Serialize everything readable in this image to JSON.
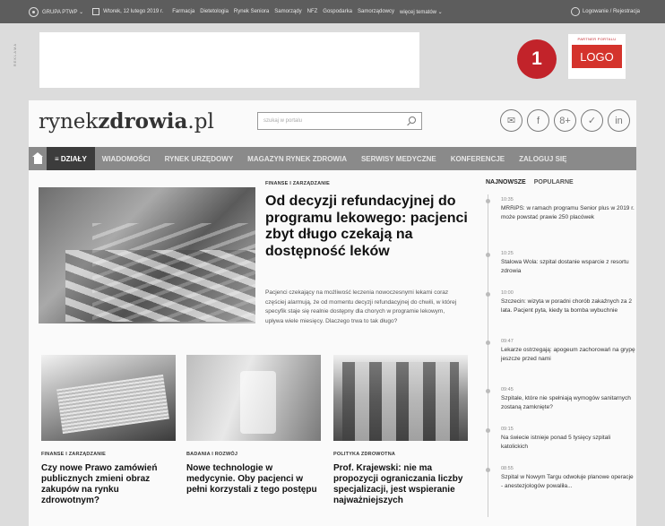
{
  "topbar": {
    "grupa": "GRUPA PTWP ⌄",
    "date": "Wtorek, 12 lutego 2019 r.",
    "links": [
      "Farmacja",
      "Dietetologia",
      "Rynek Seniora",
      "Samorządy",
      "NFZ",
      "Gospodarka",
      "Samorządowcy",
      "więcej tematów ⌄"
    ],
    "login": "Logowanie / Rejestracja"
  },
  "ad": {
    "label": "REKLAMA"
  },
  "callout_number": "1",
  "partner": {
    "label": "PARTNER PORTALU",
    "logo": "LOGO"
  },
  "site": {
    "brand_a": "rynek",
    "brand_b": "zdrowia",
    "brand_c": ".pl",
    "search_placeholder": "szukaj w portalu",
    "socials": [
      "✉",
      "f",
      "8+",
      "✓",
      "in"
    ]
  },
  "nav": {
    "dzialy": "≡ DZIAŁY",
    "items": [
      "WIADOMOŚCI",
      "RYNEK URZĘDOWY",
      "MAGAZYN RYNEK ZDROWIA",
      "SERWISY MEDYCZNE",
      "KONFERENCJE",
      "ZALOGUJ SIĘ"
    ]
  },
  "main_article": {
    "category": "FINANSE I ZARZĄDZANIE",
    "title": "Od decyzji refundacyjnej do programu lekowego: pacjenci zbyt długo czekają na dostępność leków",
    "lead": "Pacjenci czekający na możliwość leczenia nowoczesnymi lekami coraz częściej alarmują, że od momentu decyzji refundacyjnej do chwili, w której specyfik staje się realnie dostępny dla chorych w programie lekowym, upływa wiele miesięcy. Dlaczego trwa to tak długo?"
  },
  "articles": [
    {
      "category": "FINANSE I ZARZĄDZANIE",
      "title": "Czy nowe Prawo zamówień publicznych zmieni obraz zakupów na rynku zdrowotnym?"
    },
    {
      "category": "BADANIA I ROZWÓJ",
      "title": "Nowe technologie w medycynie. Oby pacjenci w pełni korzystali z tego postępu"
    },
    {
      "category": "POLITYKA ZDROWOTNA",
      "title": "Prof. Krajewski: nie ma propozycji ograniczania liczby specjalizacji, jest wspieranie najważniejszych"
    }
  ],
  "sidebar": {
    "tab_newest": "NAJNOWSZE",
    "tab_popular": "POPULARNE",
    "news": [
      {
        "time": "10:35",
        "text": "MRRiPS: w ramach programu Senior plus w 2019 r. może powstać prawie 250 placówek"
      },
      {
        "time": "10:25",
        "text": "Stalowa Wola: szpital dostanie wsparcie z resortu zdrowia"
      },
      {
        "time": "10:00",
        "text": "Szczecin: wizyta w poradni chorób zakaźnych za 2 lata. Pacjent pyta, kiedy ta bomba wybuchnie"
      },
      {
        "time": "09:47",
        "text": "Lekarze ostrzegają: apogeum zachorowań na grypę jeszcze przed nami"
      },
      {
        "time": "09:45",
        "text": "Szpitale, które nie spełniają wymogów sanitarnych zostaną zamknięte?"
      },
      {
        "time": "09:15",
        "text": "Na świecie istnieje ponad 5 tysięcy szpitali katolickich"
      },
      {
        "time": "08:55",
        "text": "Szpital w Nowym Targu odwołuje planowe operacje - anestezjologów powaliła..."
      }
    ]
  }
}
